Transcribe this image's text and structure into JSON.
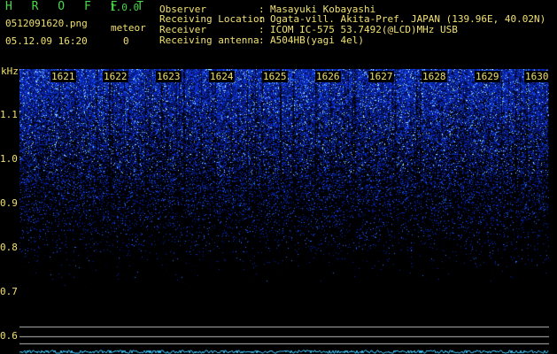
{
  "header": {
    "app_title": "H R O F F T",
    "app_version": "1.0.0",
    "file_name": "0512091620.png",
    "date_time": "05.12.09 16:20",
    "meteor_label": "meteor",
    "meteor_count": "0"
  },
  "info": [
    {
      "key": "Observer",
      "sep": ":",
      "value": "Masayuki Kobayashi"
    },
    {
      "key": "Receiving Location",
      "sep": ":",
      "value": "Ogata-vill. Akita-Pref. JAPAN (139.96E, 40.02N)"
    },
    {
      "key": "Receiver",
      "sep": ":",
      "value": "ICOM IC-575 53.7492(@LCD)MHz USB"
    },
    {
      "key": "Receiving antenna",
      "sep": ":",
      "value": "A504HB(yagi 4el)"
    }
  ],
  "spectrogram": {
    "y_unit": "kHz",
    "y_ticks": [
      "1.1",
      "1.0",
      "0.9",
      "0.8",
      "0.7",
      "0.6"
    ],
    "x_ticks": [
      "1621",
      "1622",
      "1623",
      "1624",
      "1625",
      "1626",
      "1627",
      "1628",
      "1629",
      "1630"
    ],
    "colors": {
      "text": "#f0e070",
      "title": "#48d848",
      "signal": "#2850ff",
      "trace": "#40c8ff"
    }
  }
}
